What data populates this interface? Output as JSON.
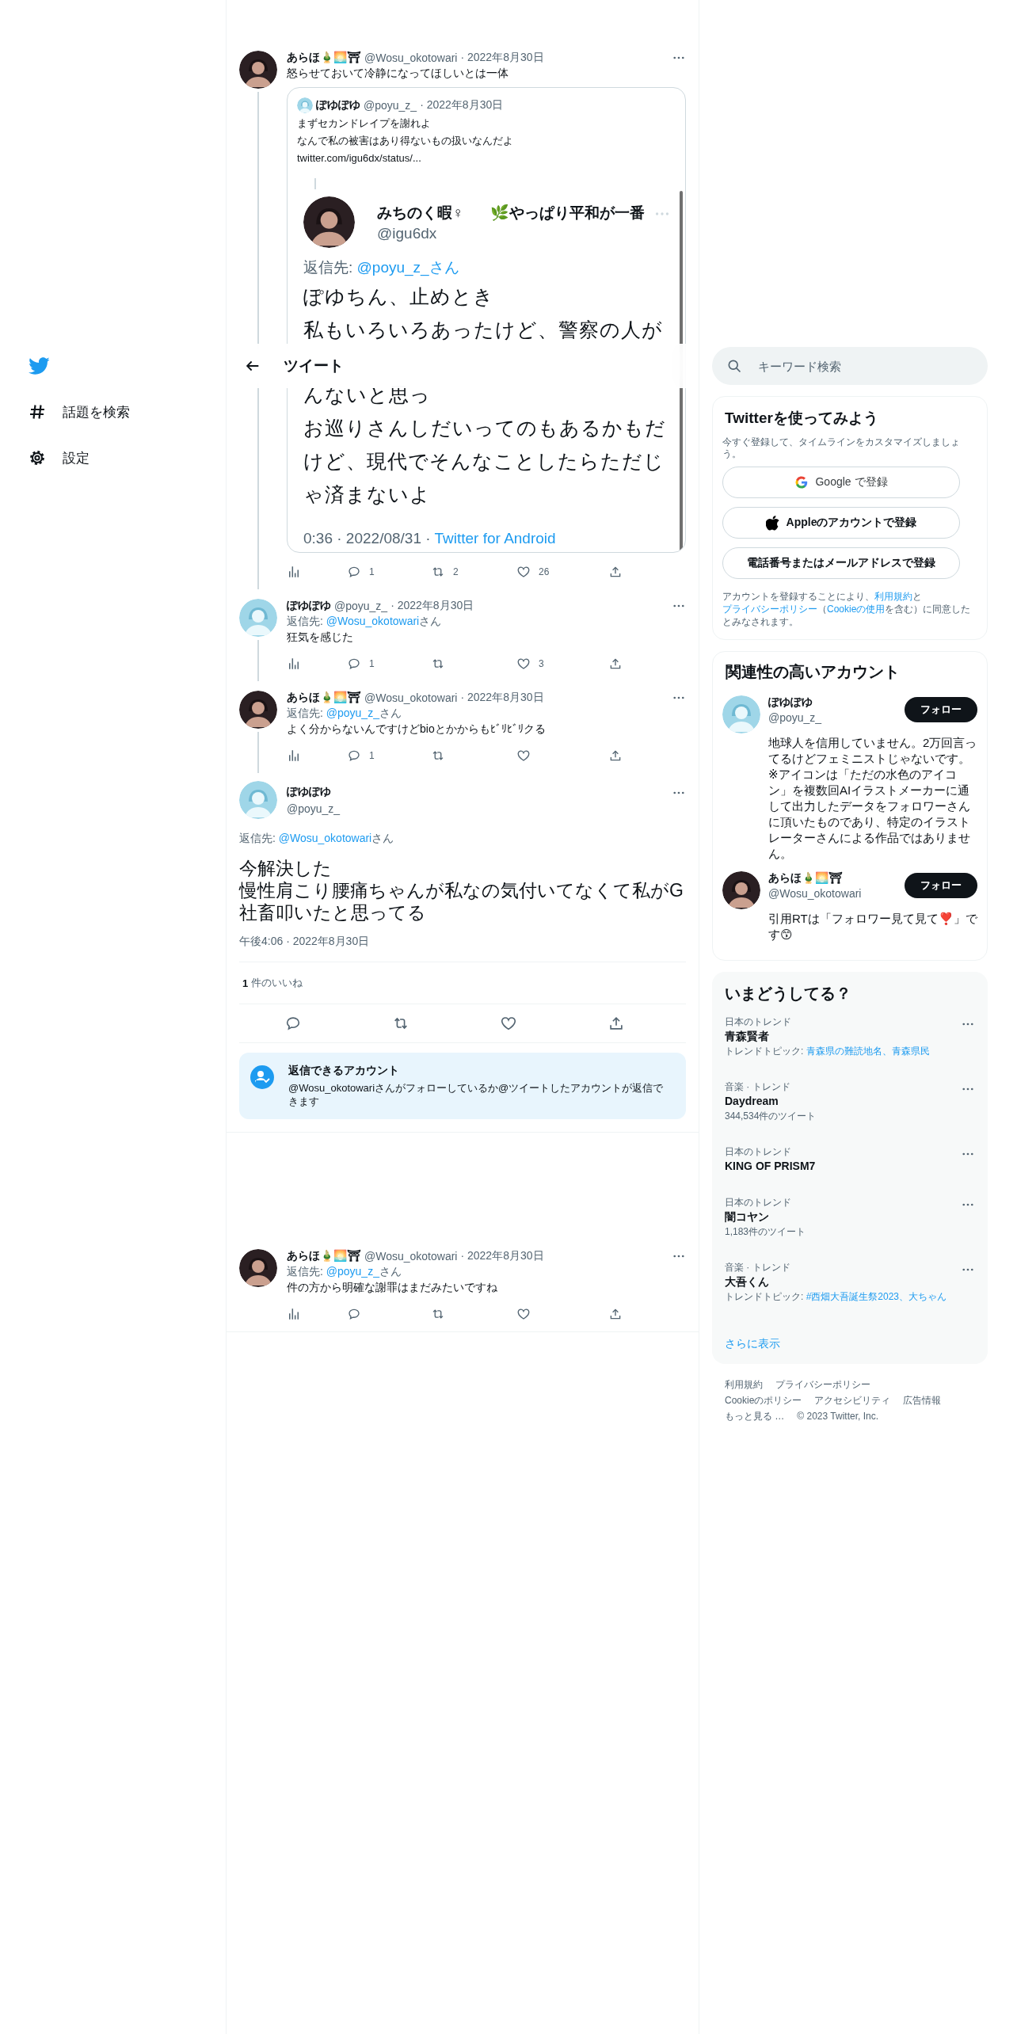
{
  "nav": {
    "items": [
      {
        "kind": "hash",
        "label": "話題を検索"
      },
      {
        "kind": "gear",
        "label": "設定"
      }
    ]
  },
  "header": {
    "title": "ツイート"
  },
  "thread": [
    {
      "avatar": {
        "kind": "photo"
      },
      "name": "あらほ🎍🌅⛩",
      "handle": "@Wosu_okotowari",
      "date": "· 2022年8月30日",
      "text": "怒らせておいて冷静になってほしいとは一体",
      "connected": true,
      "stats": {
        "replies": "1",
        "retweets": "2",
        "likes": "26"
      },
      "quote": {
        "avatar": {
          "kind": "illustration"
        },
        "name": "ぽゆぽゆ",
        "handle": "@poyu_z_",
        "date": "· 2022年8月30日",
        "text_lines": [
          "まずセカンドレイプを謝れよ",
          "なんで私の被害はあり得ないもの扱いなんだよ"
        ],
        "link": "twitter.com/igu6dx/status/...",
        "screenshot": {
          "avatar": {
            "kind": "photo"
          },
          "name": "みちのく暇♀",
          "name_extra": "🌿やっぱり平和が一番",
          "handle": "@igu6dx",
          "reply_prefix": "返信先: ",
          "reply_mention": "@poyu_z_さん",
          "body_top": [
            "ぽゆちん、止めとき",
            "私もいろいろあったけど、警察の人が"
          ],
          "body_bottom": [
            "んないと思っ",
            "お巡りさんしだいってのもあるかもだ",
            "けど、現代でそんなことしたらただじ",
            "ゃ済まないよ"
          ],
          "footer": "0:36 · 2022/08/31 · ",
          "footer_link": "Twitter for Android"
        }
      }
    },
    {
      "avatar": {
        "kind": "illustration"
      },
      "name": "ぽゆぽゆ",
      "handle": "@poyu_z_",
      "date": "· 2022年8月30日",
      "reply_to": {
        "prefix": "返信先: ",
        "mention": "@Wosu_okotowari",
        "suffix": "さん"
      },
      "text": "狂気を感じた",
      "connected": true,
      "stats": {
        "replies": "1",
        "likes": "3"
      }
    },
    {
      "avatar": {
        "kind": "photo"
      },
      "name": "あらほ🎍🌅⛩",
      "handle": "@Wosu_okotowari",
      "date": "· 2022年8月30日",
      "reply_to": {
        "prefix": "返信先: ",
        "mention": "@poyu_z_",
        "suffix": "さん"
      },
      "text": "よく分からないんですけどbioとかからもﾋﾞﾘﾋﾞﾘクる",
      "connected": true,
      "stats": {
        "replies": "1"
      }
    }
  ],
  "focus": {
    "avatar": {
      "kind": "illustration"
    },
    "name": "ぽゆぽゆ",
    "handle": "@poyu_z_",
    "reply_to": {
      "prefix": "返信先: ",
      "mention": "@Wosu_okotowari",
      "suffix": "さん"
    },
    "text_lines": [
      "今解決した",
      "慢性肩こり腰痛ちゃんが私なの気付いてなくて私がG社畜叩いたと思ってる"
    ],
    "time": "午後4:06 · 2022年8月30日",
    "likes_count": "1",
    "likes_label": "件のいいね",
    "restriction": {
      "title": "返信できるアカウント",
      "text": "@Wosu_okotowariさんがフォローしているか@ツイートしたアカウントが返信できます"
    }
  },
  "later": [
    {
      "avatar": {
        "kind": "photo"
      },
      "name": "あらほ🎍🌅⛩",
      "handle": "@Wosu_okotowari",
      "date": "· 2022年8月30日",
      "reply_to": {
        "prefix": "返信先: ",
        "mention": "@poyu_z_",
        "suffix": "さん"
      },
      "text": "件の方から明確な謝罪はまだみたいですね",
      "connected": false
    }
  ],
  "sidebar": {
    "search": {
      "placeholder": "キーワード検索"
    },
    "signup": {
      "title": "Twitterを使ってみよう",
      "subtitle": "今すぐ登録して、タイムラインをカスタマイズしましょう。",
      "buttons": [
        {
          "kind": "google",
          "label": "Google で登録"
        },
        {
          "kind": "apple",
          "label": "Appleのアカウントで登録"
        },
        {
          "kind": "plain",
          "label": "電話番号またはメールアドレスで登録"
        }
      ],
      "legal": [
        {
          "kind": "text",
          "text": "アカウントを登録することにより、"
        },
        {
          "kind": "link",
          "text": "利用規約"
        },
        {
          "kind": "text",
          "text": "と"
        },
        {
          "kind": "link",
          "text": "プライバシーポリシー"
        },
        {
          "kind": "text",
          "text": "（"
        },
        {
          "kind": "link",
          "text": "Cookieの使用"
        },
        {
          "kind": "text",
          "text": "を含む）に同意したとみなされます。"
        }
      ]
    },
    "related": {
      "title": "関連性の高いアカウント",
      "accounts": [
        {
          "avatar": {
            "kind": "illustration"
          },
          "name": "ぽゆぽゆ",
          "handle": "@poyu_z_",
          "button": "フォロー",
          "bio": "地球人を信用していません。2万回言ってるけどフェミニストじゃないです。※アイコンは「ただの水色のアイコン」を複数回AIイラストメーカーに通して出力したデータをフォロワーさんに頂いたものであり、特定のイラストレーターさんによる作品ではありません。"
        },
        {
          "avatar": {
            "kind": "photo"
          },
          "name": "あらほ🎍🌅⛩",
          "handle": "@Wosu_okotowari",
          "button": "フォロー",
          "bio": "引用RTは「フォロワー見て見て❣️」です😙"
        }
      ]
    },
    "trends": {
      "title": "いまどうしてる？",
      "items": [
        {
          "category": "日本のトレンド",
          "name": "青森賢者",
          "detail": {
            "kind": "topics",
            "prefix": "トレンドトピック: ",
            "topics": "青森県の難読地名、青森県民"
          }
        },
        {
          "category": "音楽 · トレンド",
          "name": "Daydream",
          "detail": {
            "kind": "count",
            "text": "344,534件のツイート"
          }
        },
        {
          "category": "日本のトレンド",
          "name": "KING OF PRISM7"
        },
        {
          "category": "日本のトレンド",
          "name": "闇コヤン",
          "detail": {
            "kind": "count",
            "text": "1,183件のツイート"
          }
        },
        {
          "category": "音楽 · トレンド",
          "name": "大吾くん",
          "detail": {
            "kind": "topics",
            "prefix": "トレンドトピック: ",
            "topics": "#西畑大吾誕生祭2023、大ちゃん"
          }
        }
      ],
      "more": "さらに表示"
    },
    "footer": [
      [
        "利用規約",
        "プライバシーポリシー"
      ],
      [
        "Cookieのポリシー",
        "アクセシビリティ",
        "広告情報"
      ],
      [
        "もっと見る …",
        "© 2023 Twitter, Inc."
      ]
    ]
  }
}
